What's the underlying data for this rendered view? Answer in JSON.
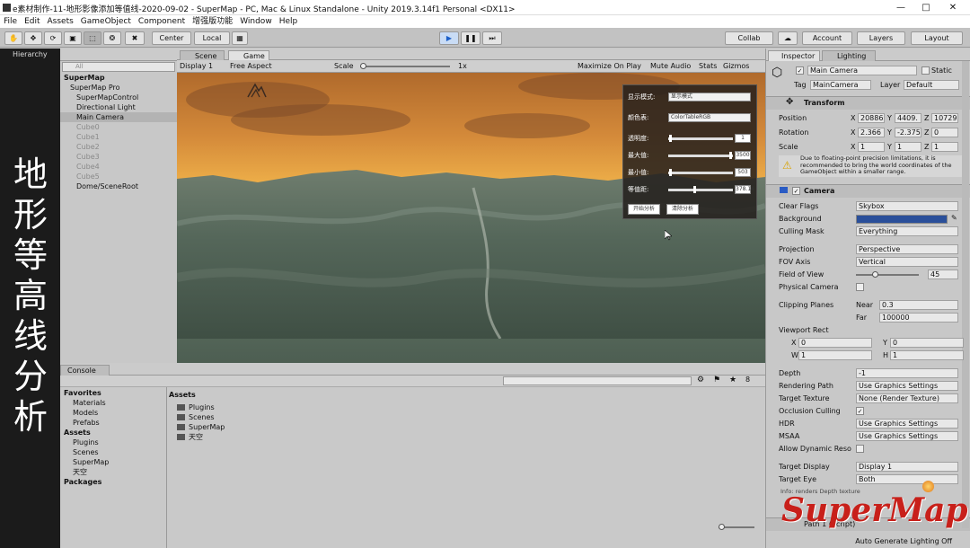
{
  "window": {
    "title": "e素材制作-11-地形影像添加等值线-2020-09-02 - SuperMap - PC, Mac & Linux Standalone - Unity 2019.3.14f1 Personal <DX11>"
  },
  "menu": [
    "File",
    "Edit",
    "Assets",
    "GameObject",
    "Component",
    "增强版功能",
    "Window",
    "Help"
  ],
  "toolbar": {
    "center": "Center",
    "local": "Local",
    "collab": "Collab",
    "account": "Account",
    "layers": "Layers",
    "layout": "Layout"
  },
  "hierarchy": {
    "tab": "Hierarchy",
    "search": "All",
    "items": [
      {
        "label": "SuperMap",
        "level": 0,
        "style": "bold"
      },
      {
        "label": "SuperMap Pro",
        "level": 1,
        "style": "normal"
      },
      {
        "label": "SuperMapControl",
        "level": 2,
        "style": "normal"
      },
      {
        "label": "Directional Light",
        "level": 2,
        "style": "normal"
      },
      {
        "label": "Main Camera",
        "level": 2,
        "style": "sel"
      },
      {
        "label": "Cube0",
        "level": 2,
        "style": "dim"
      },
      {
        "label": "Cube1",
        "level": 2,
        "style": "dim"
      },
      {
        "label": "Cube2",
        "level": 2,
        "style": "dim"
      },
      {
        "label": "Cube3",
        "level": 2,
        "style": "dim"
      },
      {
        "label": "Cube4",
        "level": 2,
        "style": "dim"
      },
      {
        "label": "Cube5",
        "level": 2,
        "style": "dim"
      },
      {
        "label": "Dome/SceneRoot",
        "level": 2,
        "style": "normal"
      }
    ]
  },
  "overlay_title": "地形等高线分析",
  "game": {
    "tab_scene": "Scene",
    "tab_game": "Game",
    "display": "Display 1",
    "aspect": "Free Aspect",
    "scale_label": "Scale",
    "scale_value": "1x",
    "maximize": "Maximize On Play",
    "mute": "Mute Audio",
    "stats": "Stats",
    "gizmos": "Gizmos",
    "panel": {
      "rows": [
        {
          "label": "显示模式:",
          "value": "显示模式"
        },
        {
          "label": "颜色表:",
          "value": "ColorTableRGB"
        }
      ],
      "sliders": [
        {
          "label": "透明度:",
          "value": "1",
          "level": 0.02
        },
        {
          "label": "最大值:",
          "value": "3500",
          "level": 0.98
        },
        {
          "label": "最小值:",
          "value": "503",
          "level": 0.02
        },
        {
          "label": "等值距:",
          "value": "378.14",
          "level": 0.4
        }
      ],
      "btn_start": "开始分析",
      "btn_clear": "清除分析"
    }
  },
  "console": {
    "project_tab": "",
    "console_tab": "Console",
    "assets_header": "Assets",
    "zoom": "8"
  },
  "project_tree": [
    {
      "label": "Favorites",
      "level": 0
    },
    {
      "label": "Materials",
      "level": 1
    },
    {
      "label": "Models",
      "level": 1
    },
    {
      "label": "Prefabs",
      "level": 1
    },
    {
      "label": "Assets",
      "level": 0
    },
    {
      "label": "Plugins",
      "level": 1
    },
    {
      "label": "Scenes",
      "level": 1
    },
    {
      "label": "SuperMap",
      "level": 1
    },
    {
      "label": "天空",
      "level": 1
    },
    {
      "label": "Packages",
      "level": 0
    }
  ],
  "assets_list": [
    "Plugins",
    "Scenes",
    "SuperMap",
    "天空"
  ],
  "inspector": {
    "tab_inspector": "Inspector",
    "tab_lighting": "Lighting",
    "object_name": "Main Camera",
    "static_label": "Static",
    "tag_label": "Tag",
    "tag_value": "MainCamera",
    "layer_label": "Layer",
    "layer_value": "Default",
    "transform": {
      "header": "Transform",
      "position": {
        "label": "Position",
        "x": "20886",
        "y": "4409.",
        "z": "10729"
      },
      "rotation": {
        "label": "Rotation",
        "x": "2.366",
        "y": "-2.375",
        "z": "0"
      },
      "scale": {
        "label": "Scale",
        "x": "1",
        "y": "1",
        "z": "1"
      },
      "warning": "Due to floating-point precision limitations, it is recommended to bring the world coordinates of the GameObject within a smaller range."
    },
    "camera": {
      "header": "Camera",
      "fields": [
        {
          "label": "Clear Flags",
          "value": "Skybox"
        },
        {
          "label": "Background",
          "value": ""
        },
        {
          "label": "Culling Mask",
          "value": "Everything"
        },
        {
          "label": "Projection",
          "value": "Perspective"
        },
        {
          "label": "FOV Axis",
          "value": "Vertical"
        },
        {
          "label": "Field of View",
          "value": "45"
        },
        {
          "label": "Physical Camera",
          "value": ""
        },
        {
          "label": "Clipping Planes",
          "value": ""
        },
        {
          "label": "Viewport Rect",
          "value": ""
        },
        {
          "label": "Depth",
          "value": "-1"
        },
        {
          "label": "Rendering Path",
          "value": "Use Graphics Settings"
        },
        {
          "label": "Target Texture",
          "value": "None (Render Texture)"
        },
        {
          "label": "Occlusion Culling",
          "value": ""
        },
        {
          "label": "HDR",
          "value": "Use Graphics Settings"
        },
        {
          "label": "MSAA",
          "value": "Use Graphics Settings"
        },
        {
          "label": "Allow Dynamic Reso",
          "value": ""
        },
        {
          "label": "Target Display",
          "value": "Display 1"
        },
        {
          "label": "Target Eye",
          "value": "Both"
        }
      ],
      "near_label": "Near",
      "near": "0.3",
      "far_label": "Far",
      "far": "100000",
      "vx": "0",
      "vy": "0",
      "vw": "1",
      "vh": "1",
      "vx_label": "X",
      "vy_label": "Y",
      "vw_label": "W",
      "vh_label": "H",
      "info": "Info: renders Depth texture",
      "bg_color": "#2a4f9a"
    },
    "next_component": "Path 1 (Script)"
  },
  "status": "Auto Generate Lighting Off",
  "watermark": "SuperMap"
}
